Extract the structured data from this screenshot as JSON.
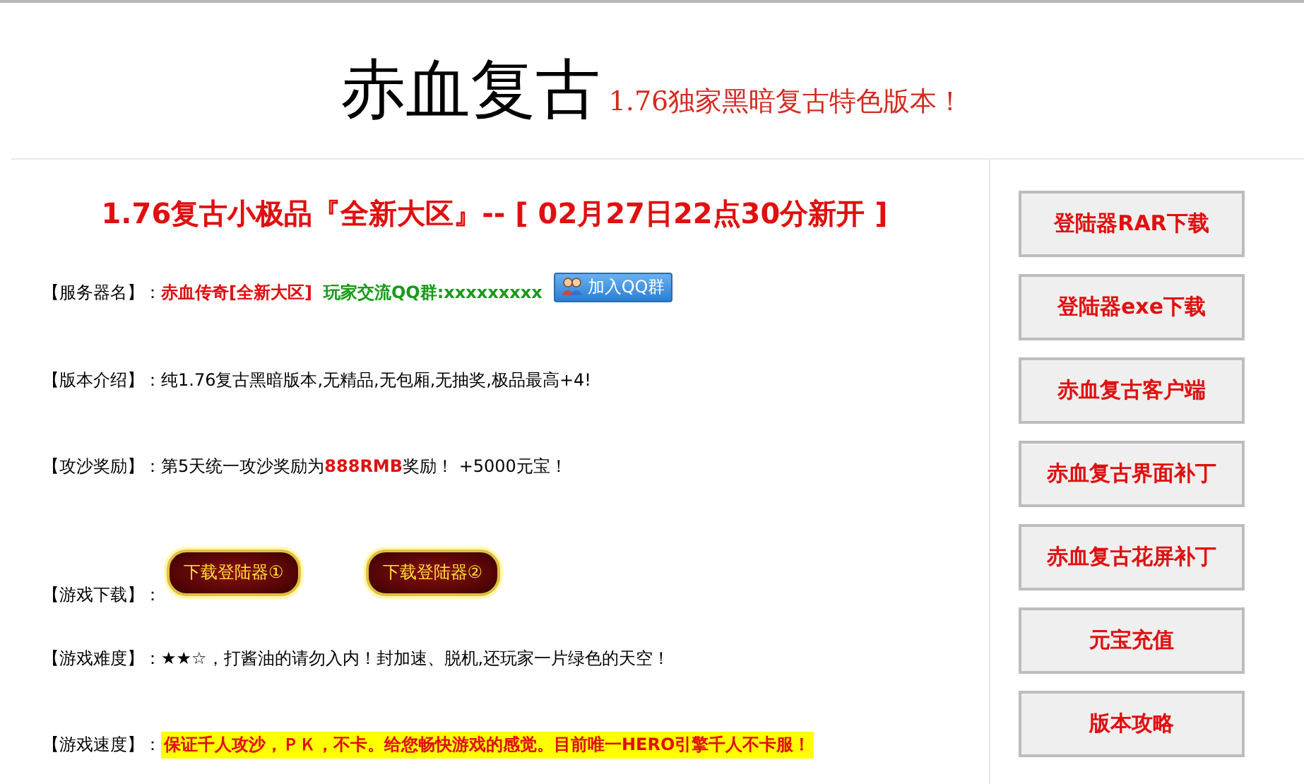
{
  "header": {
    "title": "赤血复古",
    "tagline": "1.76独家黑暗复古特色版本！"
  },
  "headline": "1.76复古小极品『全新大区』-- [ 02月27日22点30分新开 ]",
  "rows": [
    {
      "label": "【服务器名】：",
      "segments": [
        {
          "kind": "red",
          "text": "赤血传奇[全新大区]"
        },
        {
          "kind": "green",
          "text": "玩家交流QQ群:xxxxxxxxx"
        },
        {
          "kind": "qq-button",
          "text": "加入QQ群"
        }
      ]
    },
    {
      "label": "【版本介绍】：",
      "segments": [
        {
          "kind": "plain",
          "text": "纯1.76复古黑暗版本,无精品,无包厢,无抽奖,极品最高+4!"
        }
      ]
    },
    {
      "label": "【攻沙奖励】：",
      "segments": [
        {
          "kind": "plain",
          "text": "第5天统一攻沙奖励为**888RMB**奖励！  +5000元宝！"
        }
      ]
    },
    {
      "label": "【游戏下载】：",
      "segments": [
        {
          "kind": "download-button",
          "text": "下载登陆器①"
        },
        {
          "kind": "download-button",
          "text": "下载登陆器②"
        }
      ]
    },
    {
      "label": "【游戏难度】：",
      "segments": [
        {
          "kind": "plain",
          "text": "★★☆，打酱油的请勿入内！封加速、脱机,还玩家一片绿色的天空！"
        }
      ]
    },
    {
      "label": "【游戏速度】：",
      "segments": [
        {
          "kind": "highlight",
          "text": "保证千人攻沙，ＰＫ，不卡。给您畅快游戏的感觉。目前唯一HERO引擎千人不卡服！"
        }
      ]
    }
  ],
  "sidebar": [
    "登陆器RAR下载",
    "登陆器exe下载",
    "赤血复古客户端",
    "赤血复古界面补丁",
    "赤血复古花屏补丁",
    "元宝充值",
    "版本攻略"
  ]
}
